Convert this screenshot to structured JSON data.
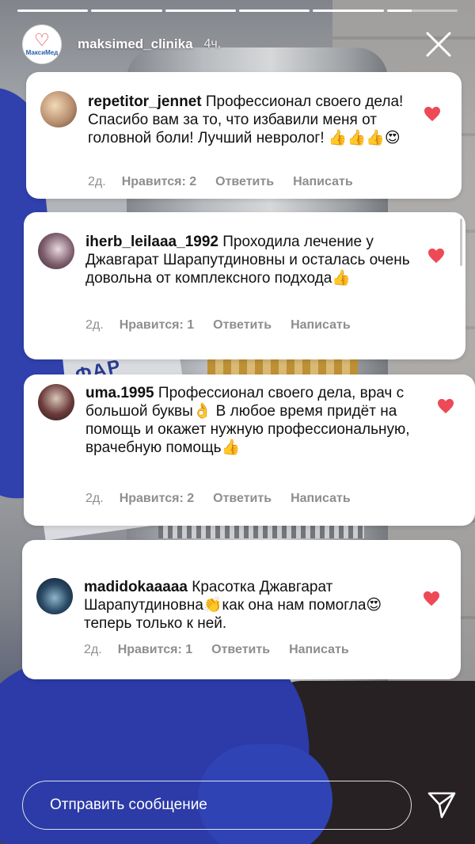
{
  "story": {
    "progress": [
      1.0,
      1.0,
      1.0,
      1.0,
      1.0,
      0.35
    ],
    "account": "maksimed_clinika",
    "time": "4ч.",
    "logo_text": "МаксиМед"
  },
  "comments": [
    {
      "username": "repetitor_jennet",
      "text": "Профессионал своего дела! Спасибо вам за то, что избавили меня от головной боли! Лучший невролог! 👍👍👍😍",
      "age": "2д.",
      "likes": "Нравится: 2",
      "reply": "Ответить",
      "message": "Написать"
    },
    {
      "username": "iherb_leilaaa_1992",
      "text": "Проходила лечение у Джавгарат Шарапутдиновны и осталась очень довольна от комплексного подхода👍",
      "age": "2д.",
      "likes": "Нравится: 1",
      "reply": "Ответить",
      "message": "Написать"
    },
    {
      "username": "uma.1995",
      "text": "Профессионал своего дела, врач с большой буквы👌 В любое время придёт на помощь и окажет нужную профессиональную, врачебную помощь👍",
      "age": "2д.",
      "likes": "Нравится: 2",
      "reply": "Ответить",
      "message": "Написать"
    },
    {
      "username": "madidokaaaaa",
      "text": "Красотка Джавгарат Шарапутдиновна👏как она нам помогла😍теперь только к ней.",
      "age": "2д.",
      "likes": "Нравится: 1",
      "reply": "Ответить",
      "message": "Написать"
    }
  ],
  "footer": {
    "placeholder": "Отправить сообщение"
  },
  "colors": {
    "like_heart": "#ed4956",
    "meta_gray": "#8e8e8e"
  },
  "icons": [
    "close-icon",
    "heart-icon",
    "send-icon"
  ]
}
